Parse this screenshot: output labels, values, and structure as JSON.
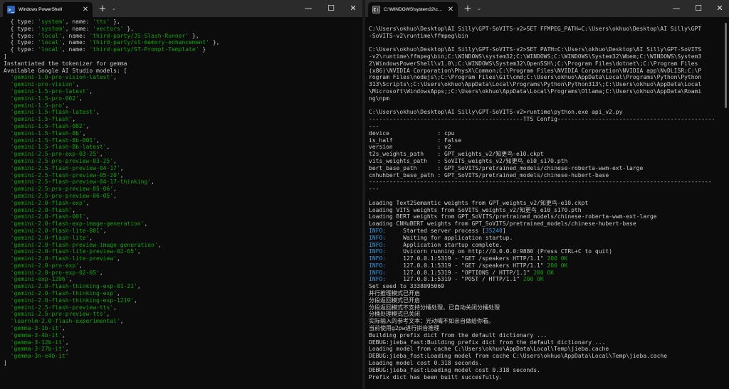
{
  "left": {
    "tab_title": "Windows PowerShell",
    "lines": [
      [
        {
          "t": "  { type: "
        },
        {
          "t": "'system'",
          "c": "c-str"
        },
        {
          "t": ", name: "
        },
        {
          "t": "'tts'",
          "c": "c-str"
        },
        {
          "t": " },"
        }
      ],
      [
        {
          "t": "  { type: "
        },
        {
          "t": "'system'",
          "c": "c-str"
        },
        {
          "t": ", name: "
        },
        {
          "t": "'vectors'",
          "c": "c-str"
        },
        {
          "t": " },"
        }
      ],
      [
        {
          "t": "  { type: "
        },
        {
          "t": "'local'",
          "c": "c-str"
        },
        {
          "t": ", name: "
        },
        {
          "t": "'third-party/JS-Slash-Runner'",
          "c": "c-str"
        },
        {
          "t": " },"
        }
      ],
      [
        {
          "t": "  { type: "
        },
        {
          "t": "'local'",
          "c": "c-str"
        },
        {
          "t": ", name: "
        },
        {
          "t": "'third-party/st-memory-enhancement'",
          "c": "c-str"
        },
        {
          "t": " },"
        }
      ],
      [
        {
          "t": "  { type: "
        },
        {
          "t": "'local'",
          "c": "c-str"
        },
        {
          "t": ", name: "
        },
        {
          "t": "'third-party/ST-Prompt-Template'",
          "c": "c-str"
        },
        {
          "t": " }"
        }
      ],
      [
        {
          "t": "]"
        }
      ],
      [
        {
          "t": "Instantiated the tokenizer for gemma"
        }
      ],
      [
        {
          "t": "Available Google AI Studio models: ["
        }
      ],
      [
        {
          "t": "  "
        },
        {
          "t": "'gemini-1.0-pro-vision-latest'",
          "c": "c-str"
        },
        {
          "t": ","
        }
      ],
      [
        {
          "t": "  "
        },
        {
          "t": "'gemini-pro-vision'",
          "c": "c-str"
        },
        {
          "t": ","
        }
      ],
      [
        {
          "t": "  "
        },
        {
          "t": "'gemini-1.5-pro-latest'",
          "c": "c-str"
        },
        {
          "t": ","
        }
      ],
      [
        {
          "t": "  "
        },
        {
          "t": "'gemini-1.5-pro-002'",
          "c": "c-str"
        },
        {
          "t": ","
        }
      ],
      [
        {
          "t": "  "
        },
        {
          "t": "'gemini-1.5-pro'",
          "c": "c-str"
        },
        {
          "t": ","
        }
      ],
      [
        {
          "t": "  "
        },
        {
          "t": "'gemini-1.5-flash-latest'",
          "c": "c-str"
        },
        {
          "t": ","
        }
      ],
      [
        {
          "t": "  "
        },
        {
          "t": "'gemini-1.5-flash'",
          "c": "c-str"
        },
        {
          "t": ","
        }
      ],
      [
        {
          "t": "  "
        },
        {
          "t": "'gemini-1.5-flash-002'",
          "c": "c-str"
        },
        {
          "t": ","
        }
      ],
      [
        {
          "t": "  "
        },
        {
          "t": "'gemini-1.5-flash-8b'",
          "c": "c-str"
        },
        {
          "t": ","
        }
      ],
      [
        {
          "t": "  "
        },
        {
          "t": "'gemini-1.5-flash-8b-001'",
          "c": "c-str"
        },
        {
          "t": ","
        }
      ],
      [
        {
          "t": "  "
        },
        {
          "t": "'gemini-1.5-flash-8b-latest'",
          "c": "c-str"
        },
        {
          "t": ","
        }
      ],
      [
        {
          "t": "  "
        },
        {
          "t": "'gemini-2.5-pro-exp-03-25'",
          "c": "c-str"
        },
        {
          "t": ","
        }
      ],
      [
        {
          "t": "  "
        },
        {
          "t": "'gemini-2.5-pro-preview-03-25'",
          "c": "c-str"
        },
        {
          "t": ","
        }
      ],
      [
        {
          "t": "  "
        },
        {
          "t": "'gemini-2.5-flash-preview-04-17'",
          "c": "c-str"
        },
        {
          "t": ","
        }
      ],
      [
        {
          "t": "  "
        },
        {
          "t": "'gemini-2.5-flash-preview-05-20'",
          "c": "c-str"
        },
        {
          "t": ","
        }
      ],
      [
        {
          "t": "  "
        },
        {
          "t": "'gemini-2.5-flash-preview-04-17-thinking'",
          "c": "c-str"
        },
        {
          "t": ","
        }
      ],
      [
        {
          "t": "  "
        },
        {
          "t": "'gemini-2.5-pro-preview-05-06'",
          "c": "c-str"
        },
        {
          "t": ","
        }
      ],
      [
        {
          "t": "  "
        },
        {
          "t": "'gemini-2.5-pro-preview-06-05'",
          "c": "c-str"
        },
        {
          "t": ","
        }
      ],
      [
        {
          "t": "  "
        },
        {
          "t": "'gemini-2.0-flash-exp'",
          "c": "c-str"
        },
        {
          "t": ","
        }
      ],
      [
        {
          "t": "  "
        },
        {
          "t": "'gemini-2.0-flash'",
          "c": "c-str"
        },
        {
          "t": ","
        }
      ],
      [
        {
          "t": "  "
        },
        {
          "t": "'gemini-2.0-flash-001'",
          "c": "c-str"
        },
        {
          "t": ","
        }
      ],
      [
        {
          "t": "  "
        },
        {
          "t": "'gemini-2.0-flash-exp-image-generation'",
          "c": "c-str"
        },
        {
          "t": ","
        }
      ],
      [
        {
          "t": "  "
        },
        {
          "t": "'gemini-2.0-flash-lite-001'",
          "c": "c-str"
        },
        {
          "t": ","
        }
      ],
      [
        {
          "t": "  "
        },
        {
          "t": "'gemini-2.0-flash-lite'",
          "c": "c-str"
        },
        {
          "t": ","
        }
      ],
      [
        {
          "t": "  "
        },
        {
          "t": "'gemini-2.0-flash-preview-image-generation'",
          "c": "c-str"
        },
        {
          "t": ","
        }
      ],
      [
        {
          "t": "  "
        },
        {
          "t": "'gemini-2.0-flash-lite-preview-02-05'",
          "c": "c-str"
        },
        {
          "t": ","
        }
      ],
      [
        {
          "t": "  "
        },
        {
          "t": "'gemini-2.0-flash-lite-preview'",
          "c": "c-str"
        },
        {
          "t": ","
        }
      ],
      [
        {
          "t": "  "
        },
        {
          "t": "'gemini-2.0-pro-exp'",
          "c": "c-str"
        },
        {
          "t": ","
        }
      ],
      [
        {
          "t": "  "
        },
        {
          "t": "'gemini-2.0-pro-exp-02-05'",
          "c": "c-str"
        },
        {
          "t": ","
        }
      ],
      [
        {
          "t": "  "
        },
        {
          "t": "'gemini-exp-1206'",
          "c": "c-str"
        },
        {
          "t": ","
        }
      ],
      [
        {
          "t": "  "
        },
        {
          "t": "'gemini-2.0-flash-thinking-exp-01-21'",
          "c": "c-str"
        },
        {
          "t": ","
        }
      ],
      [
        {
          "t": "  "
        },
        {
          "t": "'gemini-2.0-flash-thinking-exp'",
          "c": "c-str"
        },
        {
          "t": ","
        }
      ],
      [
        {
          "t": "  "
        },
        {
          "t": "'gemini-2.0-flash-thinking-exp-1219'",
          "c": "c-str"
        },
        {
          "t": ","
        }
      ],
      [
        {
          "t": "  "
        },
        {
          "t": "'gemini-2.5-flash-preview-tts'",
          "c": "c-str"
        },
        {
          "t": ","
        }
      ],
      [
        {
          "t": "  "
        },
        {
          "t": "'gemini-2.5-pro-preview-tts'",
          "c": "c-str"
        },
        {
          "t": ","
        }
      ],
      [
        {
          "t": "  "
        },
        {
          "t": "'learnlm-2.0-flash-experimental'",
          "c": "c-str"
        },
        {
          "t": ","
        }
      ],
      [
        {
          "t": "  "
        },
        {
          "t": "'gemma-3-1b-it'",
          "c": "c-str"
        },
        {
          "t": ","
        }
      ],
      [
        {
          "t": "  "
        },
        {
          "t": "'gemma-3-4b-it'",
          "c": "c-str"
        },
        {
          "t": ","
        }
      ],
      [
        {
          "t": "  "
        },
        {
          "t": "'gemma-3-12b-it'",
          "c": "c-str"
        },
        {
          "t": ","
        }
      ],
      [
        {
          "t": "  "
        },
        {
          "t": "'gemma-3-27b-it'",
          "c": "c-str"
        },
        {
          "t": ","
        }
      ],
      [
        {
          "t": "  "
        },
        {
          "t": "'gemma-3n-e4b-it'",
          "c": "c-str"
        }
      ],
      [
        {
          "t": "]"
        }
      ]
    ]
  },
  "right": {
    "tab_title": "C:\\WINDOWS\\system32\\cmd.e",
    "lines": [
      [
        {
          "t": ""
        }
      ],
      [
        {
          "t": "C:\\Users\\okhuo\\Desktop\\AI Silly\\GPT-SoVITS-v2>SET FFMPEG_PATH=C:\\Users\\okhuo\\Desktop\\AI Silly\\GPT"
        }
      ],
      [
        {
          "t": "-SoVITS-v2\\runtime\\ffmpeg\\bin"
        }
      ],
      [
        {
          "t": ""
        }
      ],
      [
        {
          "t": "C:\\Users\\okhuo\\Desktop\\AI Silly\\GPT-SoVITS-v2>SET PATH=C:\\Users\\okhuo\\Desktop\\AI Silly\\GPT-SoVITS"
        }
      ],
      [
        {
          "t": "-v2\\runtime\\ffmpeg\\bin;C:\\WINDOWS\\system32;C:\\WINDOWS;C:\\WINDOWS\\System32\\Wbem;C:\\WINDOWS\\System3"
        }
      ],
      [
        {
          "t": "2\\WindowsPowerShell\\v1.0\\;C:\\WINDOWS\\System32\\OpenSSH\\;C:\\Program Files\\dotnet\\;C:\\Program Files"
        }
      ],
      [
        {
          "t": "(x86)\\NVIDIA Corporation\\PhysX\\Common;C:\\Program Files\\NVIDIA Corporation\\NVIDIA app\\NvDLISR;C:\\P"
        }
      ],
      [
        {
          "t": "rogram Files\\nodejs\\;C:\\Program Files\\Git\\cmd;C:\\Users\\okhuo\\AppData\\Local\\Programs\\Python\\Python"
        }
      ],
      [
        {
          "t": "313\\Scripts\\;C:\\Users\\okhuo\\AppData\\Local\\Programs\\Python\\Python313\\;C:\\Users\\okhuo\\AppData\\Local"
        }
      ],
      [
        {
          "t": "\\Microsoft\\WindowsApps;;C:\\Users\\okhuo\\AppData\\Local\\Programs\\Ollama;C:\\Users\\okhuo\\AppData\\Roami"
        }
      ],
      [
        {
          "t": "ng\\npm"
        }
      ],
      [
        {
          "t": ""
        }
      ],
      [
        {
          "t": "C:\\Users\\okhuo\\Desktop\\AI Silly\\GPT-SoVITS-v2>runtime\\python.exe api_v2.py"
        }
      ],
      [
        {
          "t": "---------------------------------------------TTS Config----------------------------------------------"
        }
      ],
      [
        {
          "t": "---"
        }
      ],
      [
        {
          "t": "device              : cpu"
        }
      ],
      [
        {
          "t": "is_half             : False"
        }
      ],
      [
        {
          "t": "version             : v2"
        }
      ],
      [
        {
          "t": "t2s_weights_path    : GPT_weights_v2/知更鸟-e10.ckpt"
        }
      ],
      [
        {
          "t": "vits_weights_path   : SoVITS_weights_v2/知更鸟_e10_s170.pth"
        }
      ],
      [
        {
          "t": "bert_base_path      : GPT_SoVITS/pretrained_models/chinese-roberta-wwm-ext-large"
        }
      ],
      [
        {
          "t": "cnhuhbert_base_path : GPT_SoVITS/pretrained_models/chinese-hubert-base"
        }
      ],
      [
        {
          "t": "----------------------------------------------------------------------------------------------------"
        }
      ],
      [
        {
          "t": "---"
        }
      ],
      [
        {
          "t": ""
        }
      ],
      [
        {
          "t": "Loading Text2Semantic weights from GPT_weights_v2/知更鸟-e10.ckpt"
        }
      ],
      [
        {
          "t": "Loading VITS weights from SoVITS_weights_v2/知更鸟_e10_s170.pth"
        }
      ],
      [
        {
          "t": "Loading BERT weights from GPT_SoVITS/pretrained_models/chinese-roberta-wwm-ext-large"
        }
      ],
      [
        {
          "t": "Loading CNHuBERT weights from GPT_SoVITS/pretrained_models/chinese-hubert-base"
        }
      ],
      [
        {
          "t": "INFO:",
          "c": "c-info"
        },
        {
          "t": "     Started server process ["
        },
        {
          "t": "35240",
          "c": "c-num"
        },
        {
          "t": "]"
        }
      ],
      [
        {
          "t": "INFO:",
          "c": "c-info"
        },
        {
          "t": "     Waiting for application startup."
        }
      ],
      [
        {
          "t": "INFO:",
          "c": "c-info"
        },
        {
          "t": "     Application startup complete."
        }
      ],
      [
        {
          "t": "INFO:",
          "c": "c-info"
        },
        {
          "t": "     Uvicorn running on http://0.0.0.0:9880 (Press CTRL+C to quit)"
        }
      ],
      [
        {
          "t": "INFO:",
          "c": "c-info"
        },
        {
          "t": "     127.0.0.1:5319 - \"GET /speakers HTTP/1.1\" "
        },
        {
          "t": "200 OK",
          "c": "c-ok"
        }
      ],
      [
        {
          "t": "INFO:",
          "c": "c-info"
        },
        {
          "t": "     127.0.0.1:5319 - \"GET /speakers HTTP/1.1\" "
        },
        {
          "t": "200 OK",
          "c": "c-ok"
        }
      ],
      [
        {
          "t": "INFO:",
          "c": "c-info"
        },
        {
          "t": "     127.0.0.1:5319 - \"OPTIONS / HTTP/1.1\" "
        },
        {
          "t": "200 OK",
          "c": "c-ok"
        }
      ],
      [
        {
          "t": "INFO:",
          "c": "c-info"
        },
        {
          "t": "     127.0.0.1:5319 - \"POST / HTTP/1.1\" "
        },
        {
          "t": "200 OK",
          "c": "c-ok"
        }
      ],
      [
        {
          "t": "Set seed to 3338095069"
        }
      ],
      [
        {
          "t": "并行推理模式已开启"
        }
      ],
      [
        {
          "t": "分段返回模式已开启"
        }
      ],
      [
        {
          "t": "分段返回模式不支持分桶处理，已自动关闭分桶处理"
        }
      ],
      [
        {
          "t": "分桶处理模式已关闭"
        }
      ],
      [
        {
          "t": "实际输入的参考文本：光动嘴不如亲自做给你看。"
        }
      ],
      [
        {
          "t": "当前使用g2pw进行拼音推理"
        }
      ],
      [
        {
          "t": "Building prefix dict from the default dictionary ..."
        }
      ],
      [
        {
          "t": "DEBUG:jieba_fast:Building prefix dict from the default dictionary ..."
        }
      ],
      [
        {
          "t": "Loading model from cache C:\\Users\\okhuo\\AppData\\Local\\Temp\\jieba.cache"
        }
      ],
      [
        {
          "t": "DEBUG:jieba_fast:Loading model from cache C:\\Users\\okhuo\\AppData\\Local\\Temp\\jieba.cache"
        }
      ],
      [
        {
          "t": "Loading model cost 0.318 seconds."
        }
      ],
      [
        {
          "t": "DEBUG:jieba_fast:Loading model cost 0.318 seconds."
        }
      ],
      [
        {
          "t": "Prefix dict has been built succesfully."
        }
      ]
    ]
  },
  "icons": {
    "new_tab": "+",
    "dropdown": "⌄",
    "close": "✕",
    "minimize": "—",
    "maximize": "☐",
    "ps_glyph": ">_",
    "cmd_glyph": "C:"
  },
  "colors": {
    "background": "#0c0c0c",
    "titlebar": "#2b2b2b",
    "string_green": "#13a10e",
    "info_blue": "#3a96dd"
  }
}
